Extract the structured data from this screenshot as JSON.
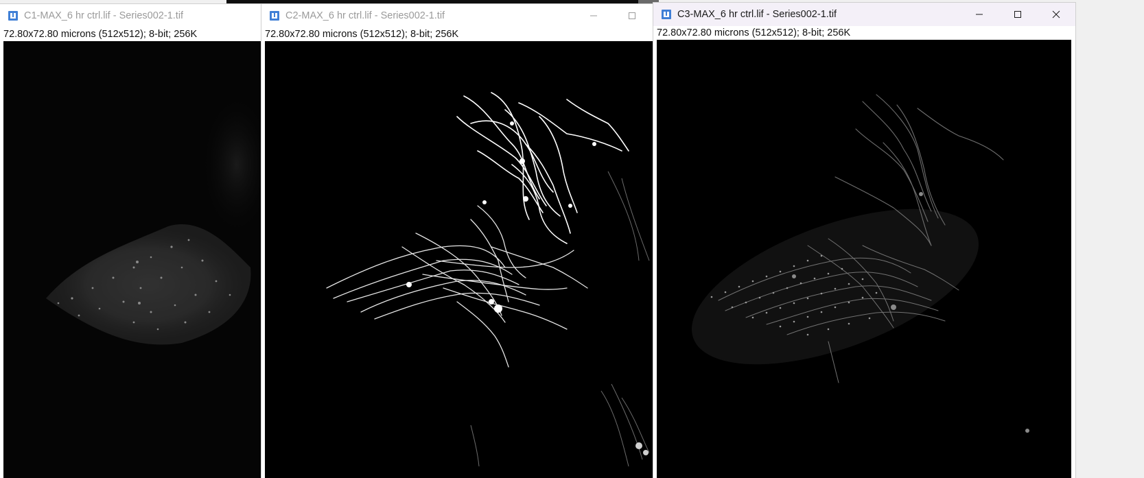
{
  "windows": [
    {
      "title": "C1-MAX_6 hr ctrl.lif - Series002-1.tif",
      "info": "72.80x72.80 microns (512x512); 8-bit; 256K",
      "state": "inactive",
      "icon": "imagej-icon"
    },
    {
      "title": "C2-MAX_6 hr ctrl.lif - Series002-1.tif",
      "info": "72.80x72.80 microns (512x512); 8-bit; 256K",
      "state": "inactive",
      "icon": "imagej-icon",
      "controls": [
        "minimize-icon",
        "maximize-icon"
      ]
    },
    {
      "title": "C3-MAX_6 hr ctrl.lif - Series002-1.tif",
      "info": "72.80x72.80 microns (512x512); 8-bit; 256K",
      "state": "active",
      "icon": "imagej-icon",
      "controls": [
        "minimize-icon",
        "maximize-icon",
        "close-icon"
      ]
    }
  ],
  "colors": {
    "image_background": "#000000",
    "active_titlebar": "#f4f0f8",
    "inactive_title_text": "#9a9a9a",
    "icon_blue": "#3f7fd6"
  }
}
